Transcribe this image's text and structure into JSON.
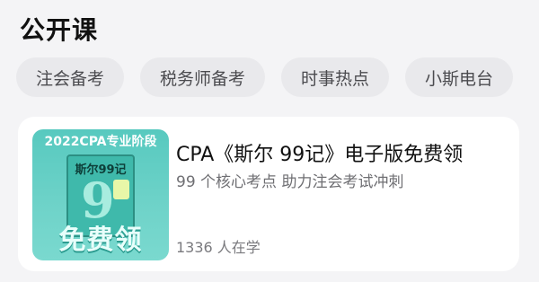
{
  "page": {
    "title": "公开课"
  },
  "tabs": [
    {
      "label": "注会备考"
    },
    {
      "label": "税务师备考"
    },
    {
      "label": "时事热点"
    },
    {
      "label": "小斯电台"
    }
  ],
  "course": {
    "thumbnail": {
      "banner": "2022CPA专业阶段",
      "book_title": "斯尔99记",
      "book_number": "9",
      "free_text": "免费领"
    },
    "title": "CPA《斯尔 99记》电子版免费领",
    "subtitle": "99 个核心考点 助力注会考试冲刺",
    "learners": "1336 人在学"
  },
  "colors": {
    "background": "#f4f4f6",
    "tab_bg": "#e9e9ec",
    "thumb_teal": "#57c9bf"
  }
}
